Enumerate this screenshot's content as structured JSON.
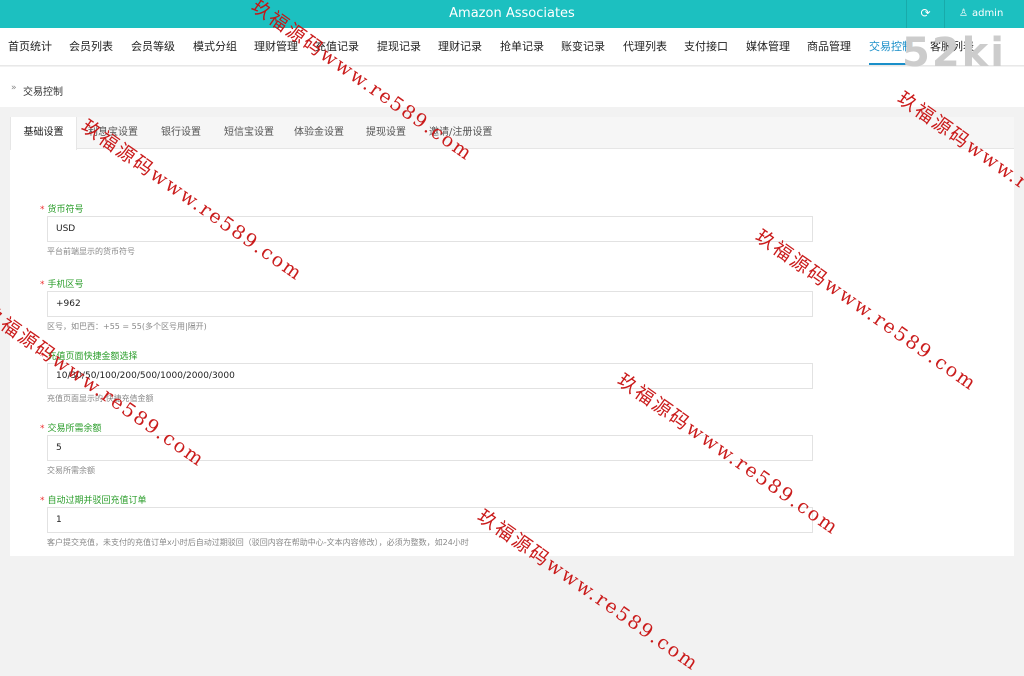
{
  "header": {
    "title": "Amazon Associates",
    "user": "admin"
  },
  "nav": {
    "items": [
      "首页统计",
      "会员列表",
      "会员等级",
      "模式分组",
      "理财管理",
      "充值记录",
      "提现记录",
      "理财记录",
      "抢单记录",
      "账变记录",
      "代理列表",
      "支付接口",
      "媒体管理",
      "商品管理",
      "交易控制",
      "客服列表"
    ],
    "active_index": 14
  },
  "brand_mark": "52ki",
  "breadcrumb": {
    "current": "交易控制"
  },
  "tabs": {
    "items": [
      "基础设置",
      "利息宝设置",
      "银行设置",
      "短信宝设置",
      "体验金设置",
      "提现设置",
      "邀请/注册设置"
    ],
    "active_index": 0
  },
  "form": {
    "fields": [
      {
        "label": "货币符号",
        "value": "USD",
        "help": "平台前端显示的货币符号"
      },
      {
        "label": "手机区号",
        "value": "+962",
        "help": "区号，如巴西：+55 = 55(多个区号用|隔开)"
      },
      {
        "label": "充值页面快捷金额选择",
        "value": "10/30/50/100/200/500/1000/2000/3000",
        "help": "充值页面显示的 快捷充值金额"
      },
      {
        "label": "交易所需余额",
        "value": "5",
        "help": "交易所需余额"
      },
      {
        "label": "自动过期并驳回充值订单",
        "value": "1",
        "help": "客户提交充值，未支付的充值订单x小时后自动过期驳回（驳回内容在帮助中心-文本内容修改），必须为整数，如24小时"
      }
    ]
  },
  "watermarks": [
    "玖福源码www.re589.com",
    "玖福源码www.re589.com",
    "玖福源码www.re589.com",
    "玖福源码www.re589.com",
    "玖福源码www.re589.com",
    "玖福源码www.re589.com",
    "玖福源码www.re589.com"
  ],
  "colors": {
    "header_bg": "#1cc0c0",
    "active_nav": "#1a8fc9",
    "label_green": "#2a9d2a",
    "required_red": "#e33333",
    "watermark": "#c81010"
  }
}
